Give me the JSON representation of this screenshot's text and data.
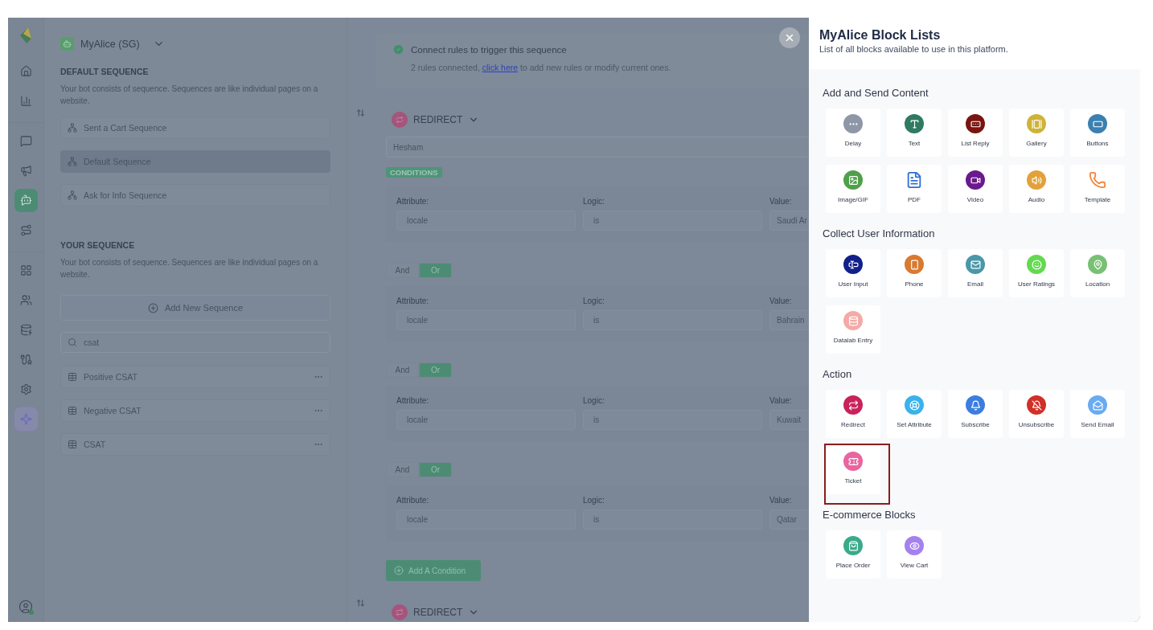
{
  "rail": {
    "groups": [
      {
        "items": [
          {
            "kind": "home",
            "selected": false
          },
          {
            "kind": "chart",
            "selected": false
          }
        ]
      },
      {
        "items": [
          {
            "kind": "chat",
            "selected": false
          },
          {
            "kind": "megaphone",
            "selected": false
          },
          {
            "kind": "bot",
            "selected": true
          },
          {
            "kind": "route",
            "selected": false
          }
        ]
      },
      {
        "items": [
          {
            "kind": "grid",
            "selected": false
          },
          {
            "kind": "users",
            "selected": false
          },
          {
            "kind": "database",
            "selected": false
          },
          {
            "kind": "cable",
            "selected": false
          },
          {
            "kind": "settings",
            "selected": false
          },
          {
            "kind": "sparkle",
            "selected": false
          }
        ]
      }
    ]
  },
  "sequences": {
    "workspace": "MyAlice (SG)",
    "default_title": "DEFAULT SEQUENCE",
    "default_description": "Your bot consists of sequence. Sequences are like individual pages on a website.",
    "default_items": [
      {
        "label": "Sent a Cart Sequence",
        "selected": false
      },
      {
        "label": "Default Sequence",
        "selected": true
      },
      {
        "label": "Ask for Info Sequence",
        "selected": false
      }
    ],
    "your_title": "YOUR SEQUENCE",
    "your_description": "Your bot consists of sequence. Sequences are like individual pages on a website.",
    "add_button": "Add New Sequence",
    "search": {
      "value": "csat"
    },
    "your_items": [
      {
        "label": "Positive CSAT"
      },
      {
        "label": "Negative CSAT"
      },
      {
        "label": "CSAT"
      }
    ]
  },
  "editor": {
    "rules": {
      "title": "Connect rules to trigger this sequence",
      "text_before": "2 rules connected,",
      "link": "click here",
      "text_after": "to add new rules or modify current ones."
    },
    "blocks": [
      {
        "title": "REDIRECT",
        "name": "Hesham",
        "conditions_badge": "CONDITIONS",
        "conditions": [
          {
            "attribute_label": "Attribute:",
            "attribute": "locale",
            "logic_label": "Logic:",
            "logic": "is",
            "value_label": "Value:",
            "value": "Saudi Ar"
          },
          {
            "joiner": [
              {
                "label": "And",
                "selected": false
              },
              {
                "label": "Or",
                "selected": true
              }
            ],
            "attribute_label": "Attribute:",
            "attribute": "locale",
            "logic_label": "Logic:",
            "logic": "is",
            "value_label": "Value:",
            "value": "Bahrain"
          },
          {
            "joiner": [
              {
                "label": "And",
                "selected": false
              },
              {
                "label": "Or",
                "selected": true
              }
            ],
            "attribute_label": "Attribute:",
            "attribute": "locale",
            "logic_label": "Logic:",
            "logic": "is",
            "value_label": "Value:",
            "value": "Kuwait"
          },
          {
            "joiner": [
              {
                "label": "And",
                "selected": false
              },
              {
                "label": "Or",
                "selected": true
              }
            ],
            "attribute_label": "Attribute:",
            "attribute": "locale",
            "logic_label": "Logic:",
            "logic": "is",
            "value_label": "Value:",
            "value": "Qatar"
          }
        ],
        "add_condition": "Add A Condition"
      },
      {
        "title": "REDIRECT"
      }
    ]
  },
  "drawer": {
    "title": "MyAlice Block Lists",
    "subtitle": "List of all blocks available to use in this platform.",
    "sections": [
      {
        "title": "Add and Send Content",
        "blocks": [
          {
            "label": "Delay",
            "kind": "delay",
            "color": "#8e97a8",
            "highlighted": false
          },
          {
            "label": "Text",
            "kind": "text",
            "color": "#2f7a62",
            "highlighted": false
          },
          {
            "label": "List Reply",
            "kind": "list",
            "color": "#7a1410",
            "highlighted": false
          },
          {
            "label": "Gallery",
            "kind": "gallery",
            "color": "#cfb238",
            "highlighted": false
          },
          {
            "label": "Buttons",
            "kind": "buttons",
            "color": "#3a80b0",
            "highlighted": false
          },
          {
            "label": "Image/GIF",
            "kind": "image",
            "color": "#4ea04a",
            "highlighted": false
          },
          {
            "label": "PDF",
            "kind": "pdf",
            "color": "#2e6ed6",
            "highlighted": false
          },
          {
            "label": "Video",
            "kind": "video",
            "color": "#6a1a8c",
            "highlighted": false
          },
          {
            "label": "Audio",
            "kind": "audio",
            "color": "#e2a13a",
            "highlighted": false
          },
          {
            "label": "Template",
            "kind": "template",
            "color": "#f0863c",
            "highlighted": false
          }
        ]
      },
      {
        "title": "Collect User Information",
        "blocks": [
          {
            "label": "User Input",
            "kind": "input",
            "color": "#12208a",
            "highlighted": false
          },
          {
            "label": "Phone",
            "kind": "phone",
            "color": "#d87a30",
            "highlighted": false
          },
          {
            "label": "Email",
            "kind": "email",
            "color": "#4a97a8",
            "highlighted": false
          },
          {
            "label": "User Ratings",
            "kind": "ratings",
            "color": "#62da4e",
            "highlighted": false
          },
          {
            "label": "Location",
            "kind": "location",
            "color": "#78c074",
            "highlighted": false
          },
          {
            "label": "Datalab Entry",
            "kind": "datalab",
            "color": "#f4aaa6",
            "highlighted": false
          }
        ]
      },
      {
        "title": "Action",
        "blocks": [
          {
            "label": "Redirect",
            "kind": "redirect",
            "color": "#c8235a",
            "highlighted": false
          },
          {
            "label": "Set Attribute",
            "kind": "attribute",
            "color": "#3ab2ea",
            "highlighted": false
          },
          {
            "label": "Subscribe",
            "kind": "subscribe",
            "color": "#3c7ee0",
            "highlighted": false
          },
          {
            "label": "Unsubscribe",
            "kind": "unsubscribe",
            "color": "#d03028",
            "highlighted": false
          },
          {
            "label": "Send Email",
            "kind": "sendmail",
            "color": "#6aaaf2",
            "highlighted": false
          },
          {
            "label": "Ticket",
            "kind": "ticket",
            "color": "#ea64a0",
            "highlighted": true
          }
        ]
      },
      {
        "title": "E-commerce Blocks",
        "blocks": [
          {
            "label": "Place Order",
            "kind": "order",
            "color": "#3aaa8a",
            "highlighted": false
          },
          {
            "label": "View Cart",
            "kind": "cart",
            "color": "#a482ee",
            "highlighted": false
          }
        ]
      }
    ]
  }
}
